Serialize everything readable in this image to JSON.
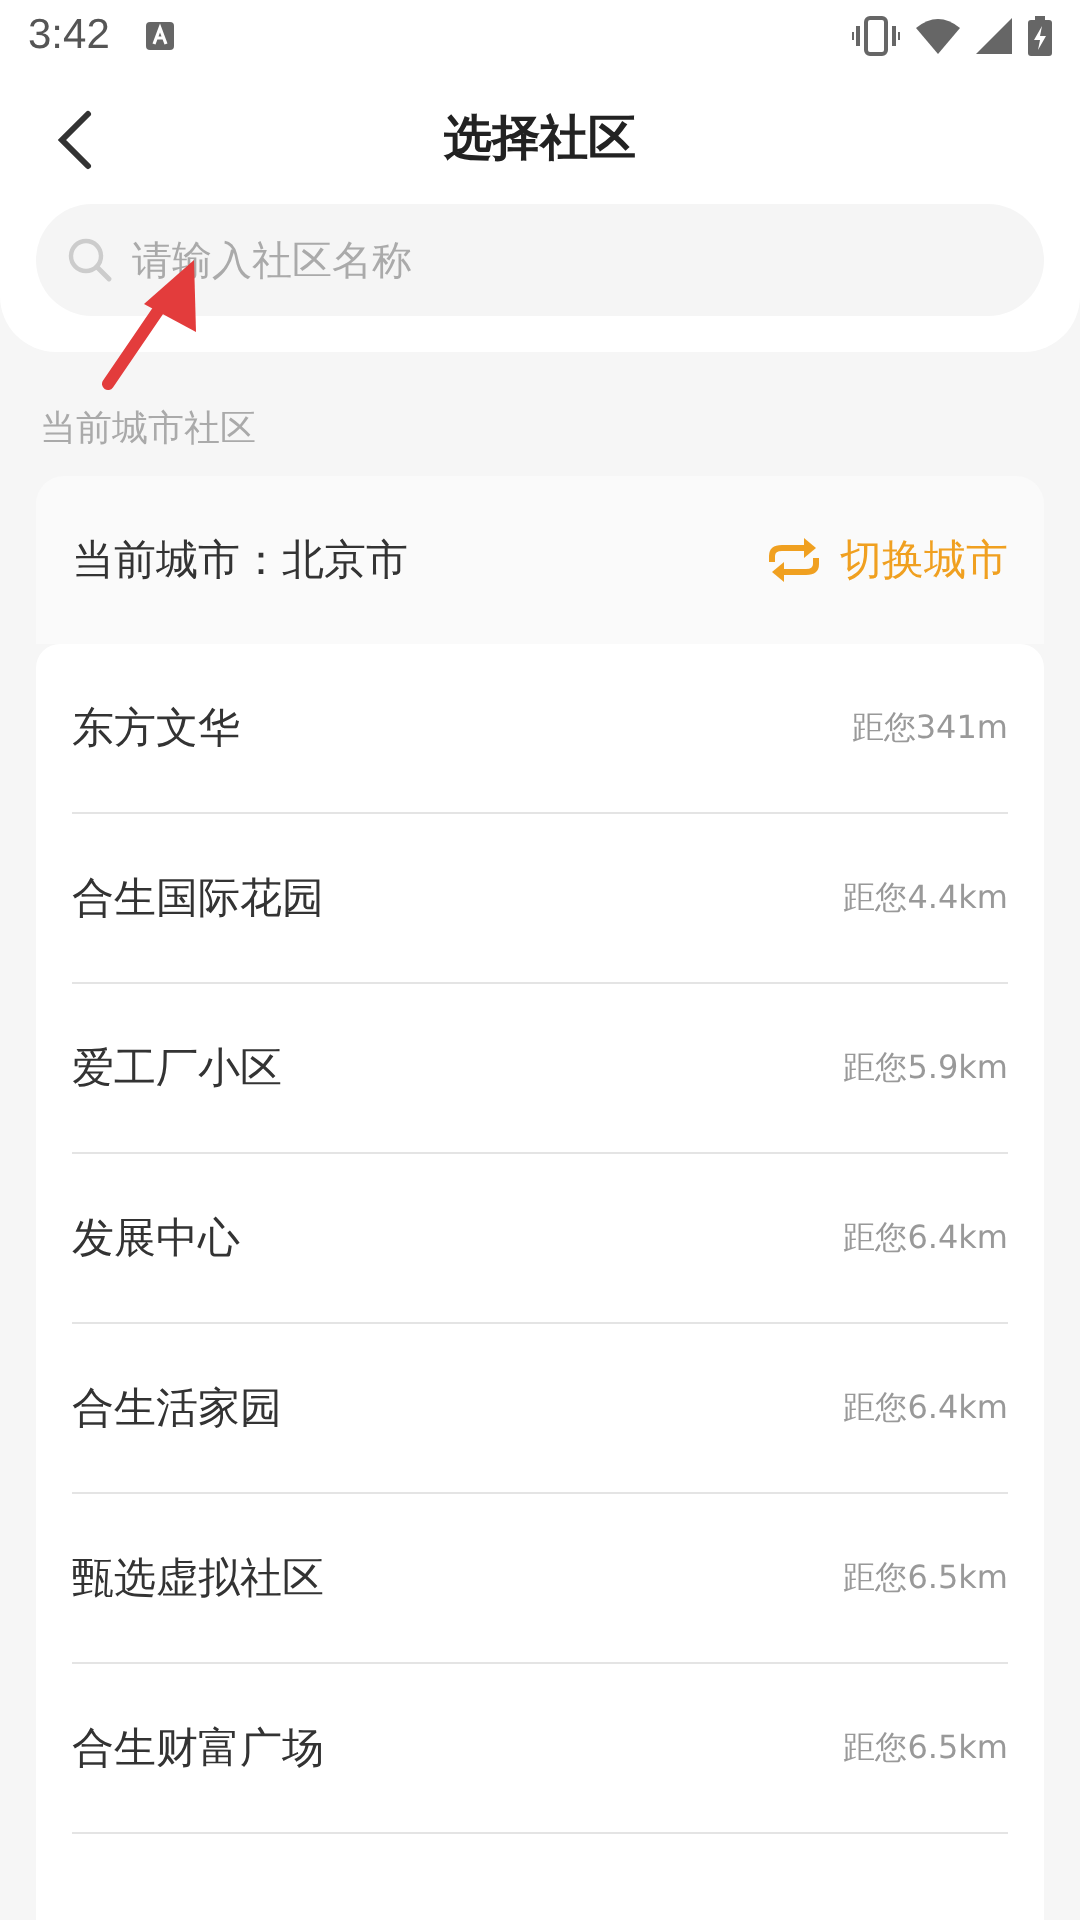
{
  "status_bar": {
    "time": "3:42"
  },
  "header": {
    "title": "选择社区"
  },
  "search": {
    "placeholder": "请输入社区名称"
  },
  "section_label": "当前城市社区",
  "current_city": {
    "label": "当前城市：北京市",
    "switch_label": "切换城市"
  },
  "communities": [
    {
      "name": "东方文华",
      "distance": "距您341m"
    },
    {
      "name": "合生国际花园",
      "distance": "距您4.4km"
    },
    {
      "name": "爱工厂小区",
      "distance": "距您5.9km"
    },
    {
      "name": "发展中心",
      "distance": "距您6.4km"
    },
    {
      "name": "合生活家园",
      "distance": "距您6.4km"
    },
    {
      "name": "甄选虚拟社区",
      "distance": "距您6.5km"
    },
    {
      "name": "合生财富广场",
      "distance": "距您6.5km"
    }
  ]
}
